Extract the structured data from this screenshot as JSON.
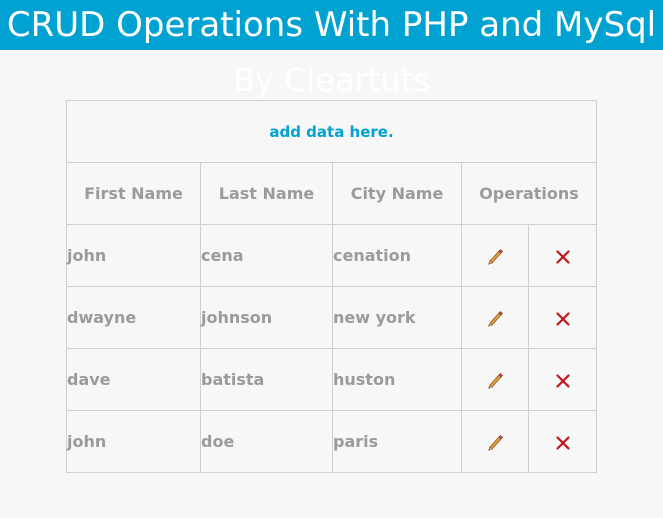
{
  "header": {
    "title": "CRUD Operations With PHP and MySql",
    "subtitle": "By Cleartuts",
    "accent_color": "#00a2d1"
  },
  "add_link": "add data here.",
  "columns": [
    "First Name",
    "Last Name",
    "City Name",
    "Operations"
  ],
  "rows": [
    {
      "first": "john",
      "last": "cena",
      "city": "cenation"
    },
    {
      "first": "dwayne",
      "last": "johnson",
      "city": "new york"
    },
    {
      "first": "dave",
      "last": "batista",
      "city": "huston"
    },
    {
      "first": "john",
      "last": "doe",
      "city": "paris"
    }
  ],
  "icons": {
    "edit": "pencil-icon",
    "delete": "cross-icon"
  }
}
